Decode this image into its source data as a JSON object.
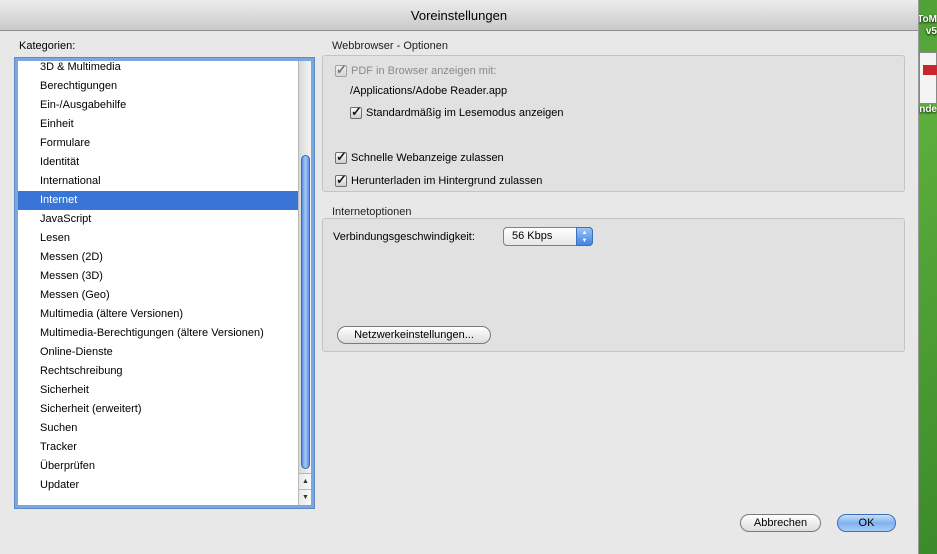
{
  "window": {
    "title": "Voreinstellungen"
  },
  "desktop": {
    "text_top": "ToM",
    "text_mid": "v5",
    "text_low": "nde"
  },
  "categories": {
    "label": "Kategorien:",
    "items": [
      "3D & Multimedia",
      "Berechtigungen",
      "Ein-/Ausgabehilfe",
      "Einheit",
      "Formulare",
      "Identität",
      "International",
      "Internet",
      "JavaScript",
      "Lesen",
      "Messen (2D)",
      "Messen (3D)",
      "Messen (Geo)",
      "Multimedia (ältere Versionen)",
      "Multimedia-Berechtigungen (ältere Versionen)",
      "Online-Dienste",
      "Rechtschreibung",
      "Sicherheit",
      "Sicherheit (erweitert)",
      "Suchen",
      "Tracker",
      "Überprüfen",
      "Updater"
    ],
    "selected": "Internet"
  },
  "webbrowser": {
    "title": "Webbrowser - Optionen",
    "pdf_in_browser": {
      "label": "PDF in Browser anzeigen mit:",
      "checked": true,
      "enabled": false
    },
    "app_path": "/Applications/Adobe Reader.app",
    "read_mode": {
      "label": "Standardmäßig im Lesemodus anzeigen",
      "checked": true
    },
    "fast_web_view": {
      "label": "Schnelle Webanzeige zulassen",
      "checked": true
    },
    "background_download": {
      "label": "Herunterladen im Hintergrund zulassen",
      "checked": true
    }
  },
  "internet_options": {
    "title": "Internetoptionen",
    "speed_label": "Verbindungsgeschwindigkeit:",
    "speed_value": "56 Kbps",
    "network_button": "Netzwerkeinstellungen..."
  },
  "footer": {
    "cancel": "Abbrechen",
    "ok": "OK"
  }
}
